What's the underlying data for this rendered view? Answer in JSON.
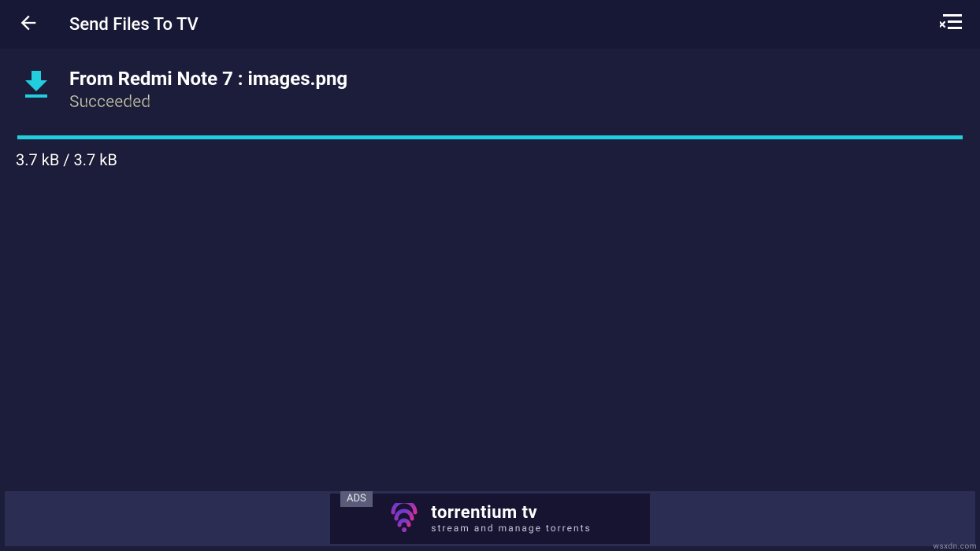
{
  "header": {
    "title": "Send Files To TV"
  },
  "transfer": {
    "title": "From Redmi Note 7 : images.png",
    "status": "Succeeded",
    "size_text": "3.7 kB / 3.7 kB"
  },
  "ad": {
    "label": "ADS",
    "title": "torrentium tv",
    "subtitle": "stream and manage torrents"
  },
  "watermark": "wsxdn.com",
  "colors": {
    "accent": "#22cddd",
    "bg": "#1c1d3b",
    "bar": "#171836"
  }
}
